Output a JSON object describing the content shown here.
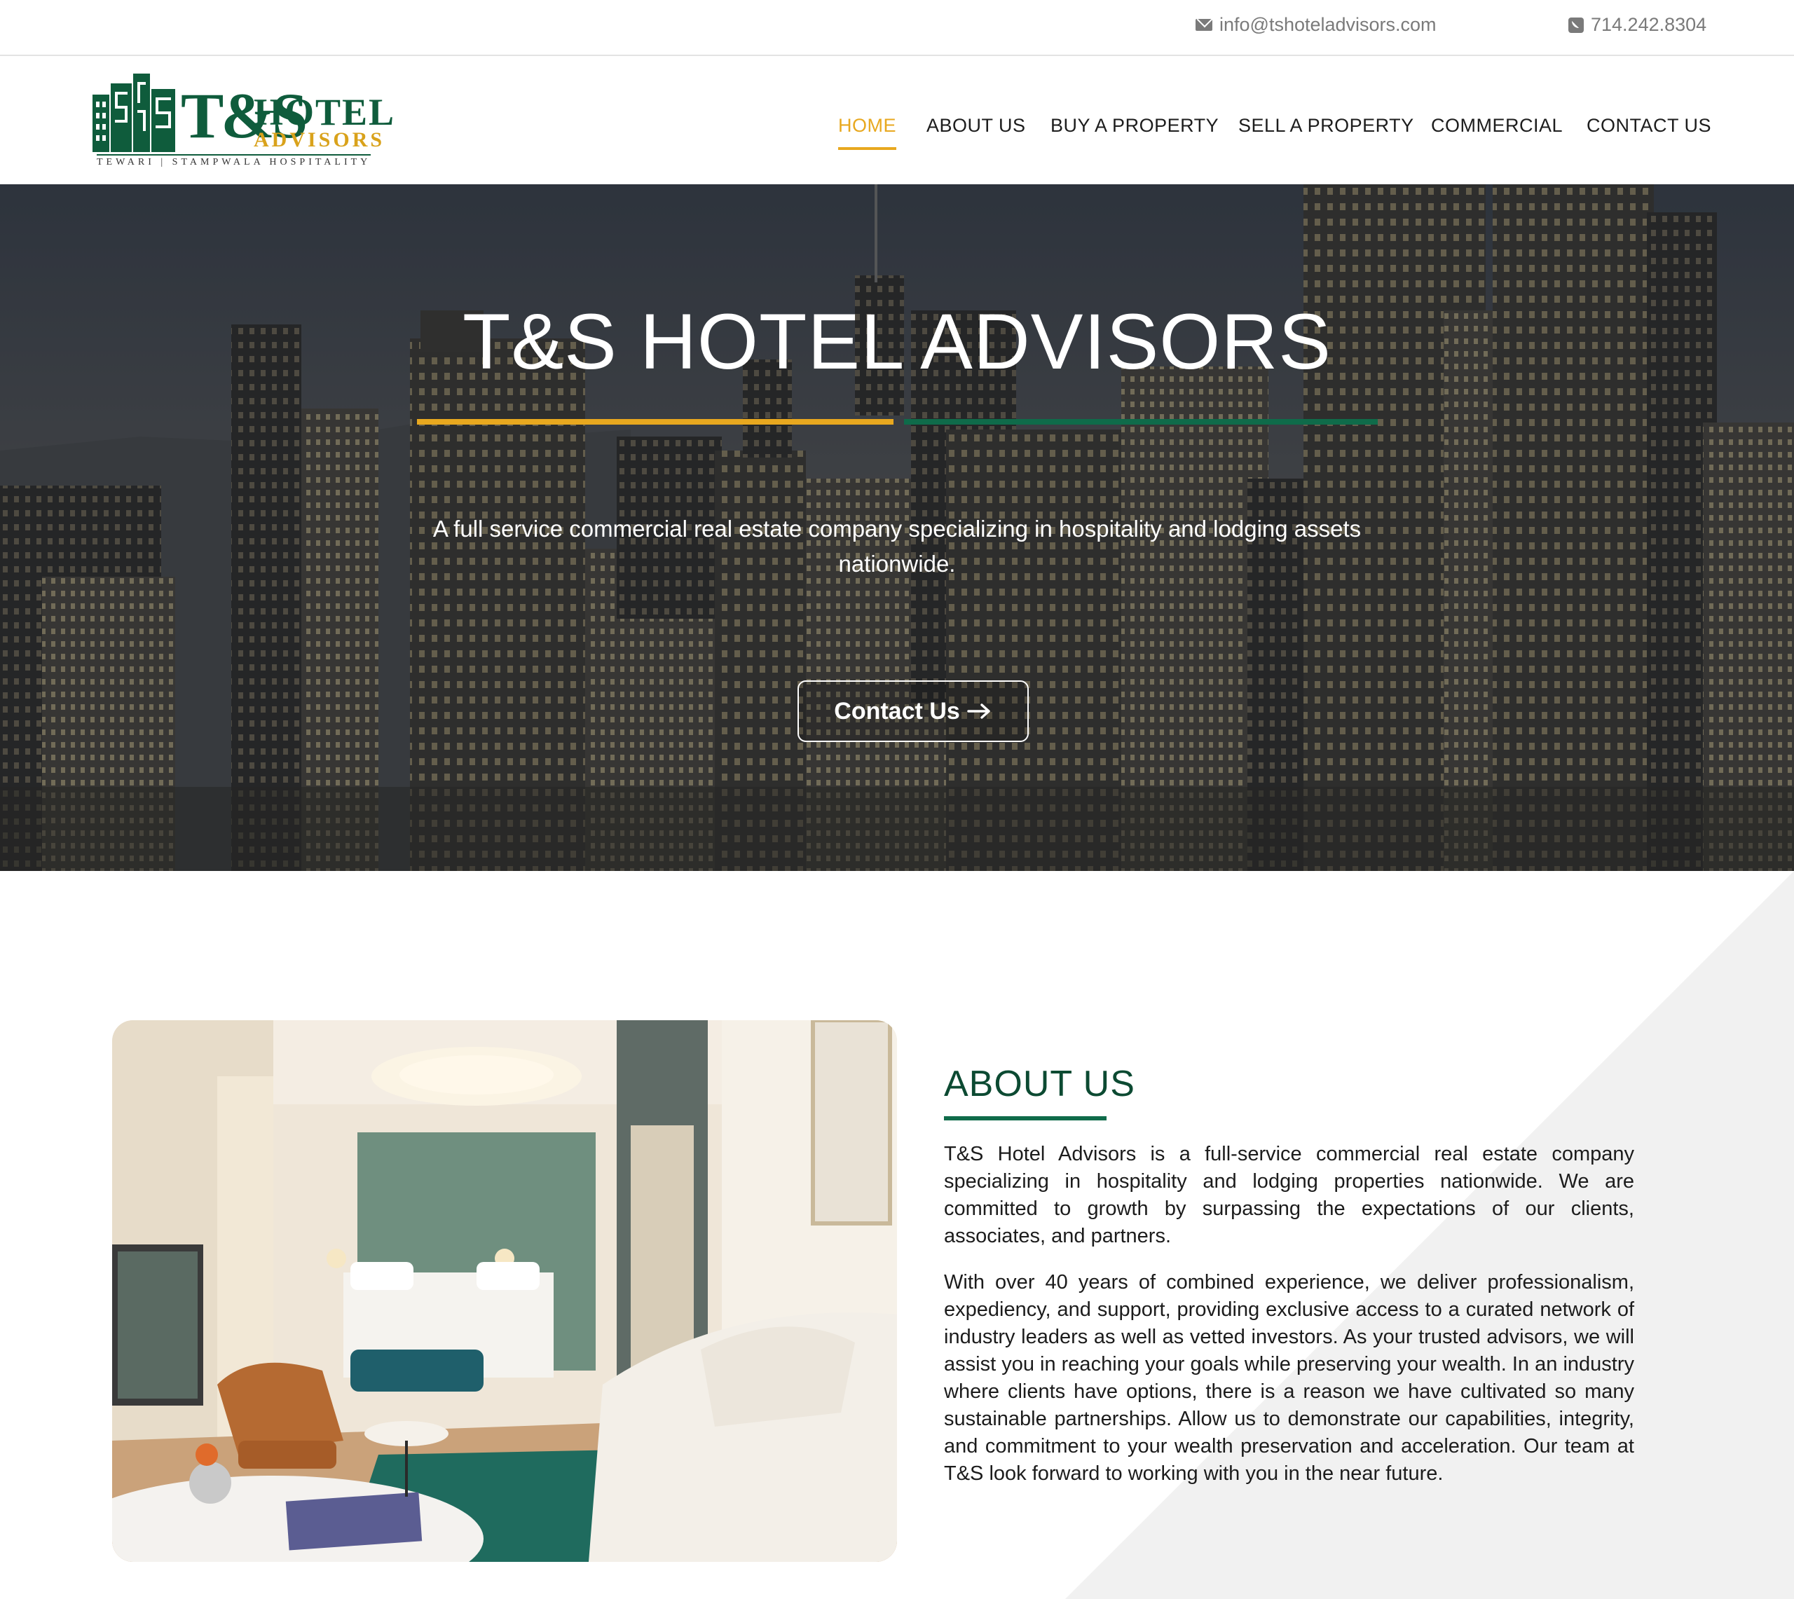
{
  "topbar": {
    "email": "info@tshoteladvisors.com",
    "phone": "714.242.8304",
    "email_icon": "envelope-icon",
    "phone_icon": "phone-square-icon"
  },
  "logo": {
    "ts": "T&S",
    "hotel": "HOTEL",
    "advisors": "ADVISORS",
    "tagline": "TEWARI | STAMPWALA HOSPITALITY"
  },
  "nav": {
    "items": [
      {
        "label": "HOME",
        "active": true
      },
      {
        "label": "ABOUT US"
      },
      {
        "label": "BUY A PROPERTY"
      },
      {
        "label": "SELL A PROPERTY"
      },
      {
        "label": "COMMERCIAL"
      },
      {
        "label": "CONTACT US"
      }
    ]
  },
  "hero": {
    "title": "T&S HOTEL ADVISORS",
    "subtitle": "A full service commercial real estate company specializing in hospitality and lodging assets nationwide.",
    "cta_label": "Contact Us",
    "cta_icon": "arrow-right-icon"
  },
  "about": {
    "heading": "ABOUT US",
    "paragraph1": "T&S Hotel Advisors is a full-service commercial real estate company specializing in hospitality and lodging properties nationwide. We are committed to growth by surpassing the expectations of our clients, associates, and partners.",
    "paragraph2": "With over 40 years of combined experience, we deliver professionalism, expediency, and support, providing exclusive access to a curated network of industry leaders as well as vetted investors. As your trusted advisors, we will assist you in reaching your goals while preserving your wealth. In an industry where clients have options, there is a reason we have cultivated so many sustainable partnerships. Allow us to demonstrate our capabilities, integrity, and commitment to your wealth preservation and acceleration. Our team at T&S look forward to working with you in the near future."
  },
  "colors": {
    "accent_gold": "#e8a81f",
    "brand_green": "#0f6b4a",
    "heading_green": "#0c4a32"
  }
}
